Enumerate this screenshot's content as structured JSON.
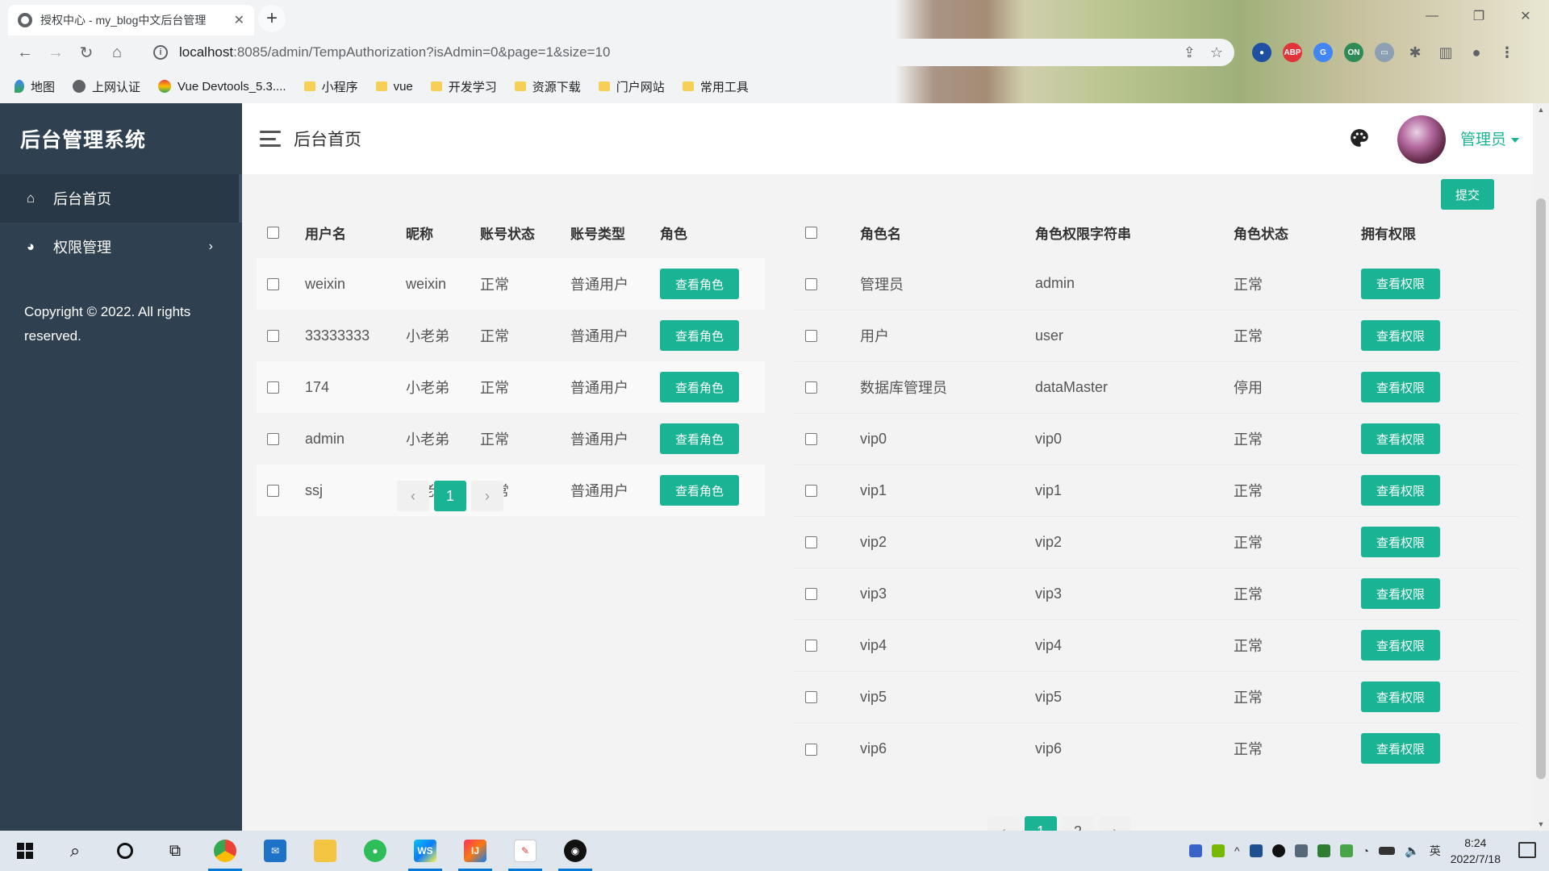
{
  "browser": {
    "tab_title": "授权中心 - my_blog中文后台管理",
    "url_host": "localhost",
    "url_rest": ":8085/admin/TempAuthorization?isAdmin=0&page=1&size=10",
    "bookmarks": [
      "地图",
      "上网认证",
      "Vue Devtools_5.3....",
      "小程序",
      "vue",
      "开发学习",
      "资源下载",
      "门户网站",
      "常用工具"
    ]
  },
  "sidebar": {
    "brand": "后台管理系统",
    "items": [
      {
        "label": "后台首页"
      },
      {
        "label": "权限管理"
      }
    ],
    "copyright": "Copyright © 2022. All rights reserved."
  },
  "header": {
    "title": "后台首页",
    "user": "管理员"
  },
  "submit_label": "提交",
  "users_table": {
    "headers": [
      "用户名",
      "昵称",
      "账号状态",
      "账号类型",
      "角色"
    ],
    "button_label": "查看角色",
    "rows": [
      {
        "username": "weixin",
        "nickname": "weixin",
        "status": "正常",
        "type": "普通用户"
      },
      {
        "username": "33333333",
        "nickname": "小老弟",
        "status": "正常",
        "type": "普通用户"
      },
      {
        "username": "174",
        "nickname": "小老弟",
        "status": "正常",
        "type": "普通用户"
      },
      {
        "username": "admin",
        "nickname": "小老弟",
        "status": "正常",
        "type": "普通用户"
      },
      {
        "username": "ssj",
        "nickname": "小老弟",
        "status": "正常",
        "type": "普通用户"
      }
    ],
    "pager": {
      "prev": "‹",
      "pages": [
        "1"
      ],
      "next": "›"
    }
  },
  "roles_table": {
    "headers": [
      "角色名",
      "角色权限字符串",
      "角色状态",
      "拥有权限"
    ],
    "button_label": "查看权限",
    "rows": [
      {
        "name": "管理员",
        "key": "admin",
        "status": "正常"
      },
      {
        "name": "用户",
        "key": "user",
        "status": "正常"
      },
      {
        "name": "数据库管理员",
        "key": "dataMaster",
        "status": "停用"
      },
      {
        "name": "vip0",
        "key": "vip0",
        "status": "正常"
      },
      {
        "name": "vip1",
        "key": "vip1",
        "status": "正常"
      },
      {
        "name": "vip2",
        "key": "vip2",
        "status": "正常"
      },
      {
        "name": "vip3",
        "key": "vip3",
        "status": "正常"
      },
      {
        "name": "vip4",
        "key": "vip4",
        "status": "正常"
      },
      {
        "name": "vip5",
        "key": "vip5",
        "status": "正常"
      },
      {
        "name": "vip6",
        "key": "vip6",
        "status": "正常"
      }
    ],
    "pager": {
      "prev": "‹",
      "pages": [
        "1",
        "2"
      ],
      "next": "›"
    }
  },
  "taskbar": {
    "ime": "英",
    "time": "8:24",
    "date": "2022/7/18"
  },
  "colors": {
    "accent": "#1ab394",
    "sidebar": "#2f4050",
    "sidebar_active": "#293846"
  }
}
